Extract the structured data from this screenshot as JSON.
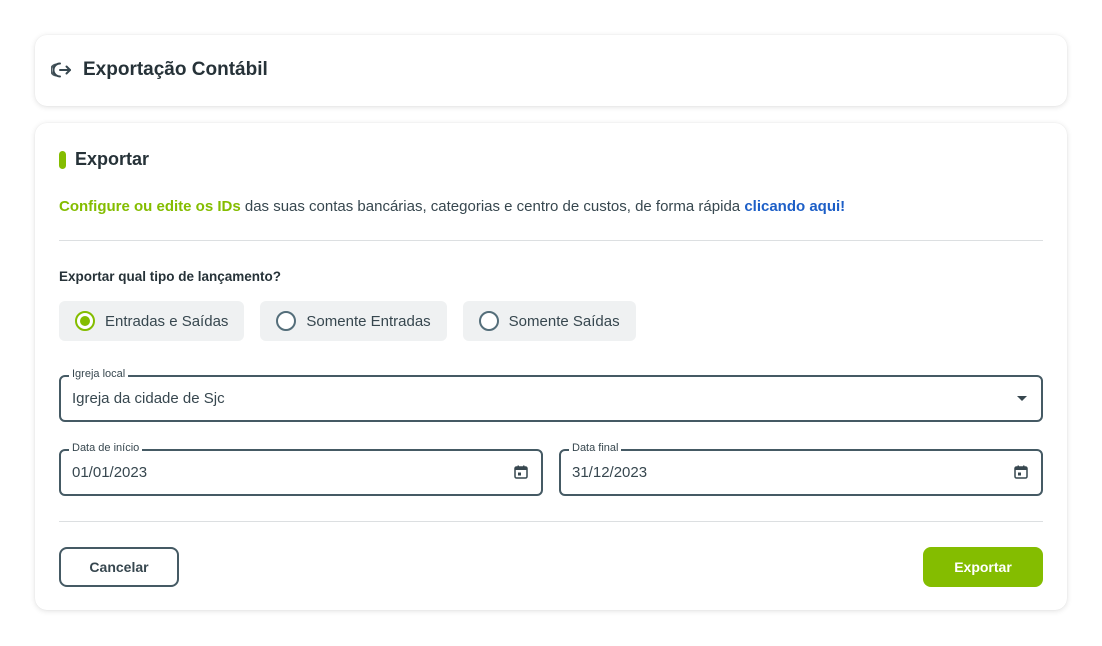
{
  "header": {
    "icon": "exit-arrow-icon",
    "title": "Exportação Contábil"
  },
  "section": {
    "title": "Exportar"
  },
  "info": {
    "link_green": "Configure ou edite os IDs",
    "middle_text": " das suas contas bancárias, categorias e centro de custos, de forma rápida ",
    "link_blue": "clicando aqui!"
  },
  "question": "Exportar qual tipo de lançamento?",
  "radio_options": [
    {
      "label": "Entradas e Saídas",
      "checked": true
    },
    {
      "label": "Somente Entradas",
      "checked": false
    },
    {
      "label": "Somente Saídas",
      "checked": false
    }
  ],
  "church_field": {
    "label": "Igreja local",
    "value": "Igreja da cidade de Sjc"
  },
  "start_date": {
    "label": "Data de início",
    "value": "01/01/2023"
  },
  "end_date": {
    "label": "Data final",
    "value": "31/12/2023"
  },
  "buttons": {
    "cancel": "Cancelar",
    "export": "Exportar"
  },
  "colors": {
    "accent": "#84bd00",
    "link_blue": "#1d5fc7",
    "border": "#455a64"
  }
}
